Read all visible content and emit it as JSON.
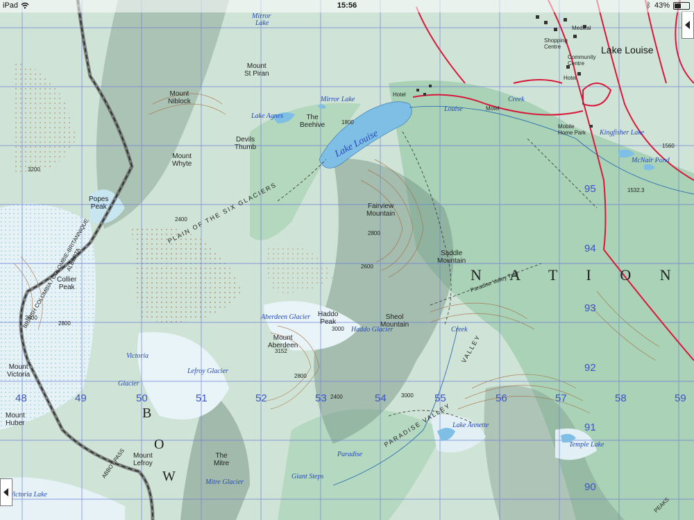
{
  "status_bar": {
    "device": "iPad",
    "time": "15:56",
    "bluetooth_icon": "bluetooth-icon",
    "battery_percent": "43%",
    "battery_level": 0.43
  },
  "map": {
    "town": "Lake Louise",
    "region_text": "N A T I O N",
    "bow_letters": [
      "B",
      "O",
      "W"
    ],
    "peaks": [
      {
        "name": "Mount",
        "name2": "St Piran"
      },
      {
        "name": "Mount",
        "name2": "Niblock"
      },
      {
        "name": "The",
        "name2": "Beehive"
      },
      {
        "name": "Devils",
        "name2": "Thumb"
      },
      {
        "name": "Mount",
        "name2": "Whyte"
      },
      {
        "name": "Popes",
        "name2": "Peak"
      },
      {
        "name": "Collier",
        "name2": "Peak"
      },
      {
        "name": "Fairview",
        "name2": "Mountain"
      },
      {
        "name": "Saddle",
        "name2": "Mountain"
      },
      {
        "name": "Haddo",
        "name2": "Peak"
      },
      {
        "name": "Sheol",
        "name2": "Mountain"
      },
      {
        "name": "Mount",
        "name2": "Aberdeen"
      },
      {
        "name": "Mount",
        "name2": "Victoria"
      },
      {
        "name": "Mount",
        "name2": "Huber"
      },
      {
        "name": "Mount",
        "name2": "Lefroy"
      },
      {
        "name": "The",
        "name2": "Mitre"
      }
    ],
    "water": {
      "lake_louise": "Lake Louise",
      "lake_agnes": "Lake Agnes",
      "mirror_lake": "Mirror Lake",
      "louise_creek": "Louise",
      "creek": "Creek",
      "kingfisher_lake": "Kingfisher Lake",
      "mcnair_pond": "McNair Pond",
      "aberdeen_glacier": "Aberdeen Glacier",
      "haddo_glacier": "Haddo Glacier",
      "victoria": "Victoria",
      "glacier": "Glacier",
      "lefroy_glacier": "Lefroy Glacier",
      "lake_annette": "Lake Annette",
      "temple_lake": "Temple Lake",
      "paradise_creek": "Paradise",
      "paradise_creek2": "Creek",
      "mitre_glacier": "Mitre Glacier",
      "giant_steps": "Giant Steps",
      "victoria_lake": "Victoria Lake",
      "mirror_label": "Mirror",
      "lake_label": "Lake"
    },
    "route_labels": {
      "six_glaciers": "PLAIN OF THE SIX GLACIERS",
      "paradise_valley": "PARADISE VALLEY",
      "valley": "VALLEY",
      "paradise_valley_trail": "Paradise Valley Trail",
      "bc_alberta": "BRITISH COLUMBIA / COLOMBIE-BRITANNIQUE",
      "alberta": "ALBERTA",
      "abbot_pass": "ABBOT PASS",
      "peaks": "PEAKS"
    },
    "places": {
      "hotel": "Hotel",
      "motel": "Motel",
      "mobile_home_park": "Mobile Home Park",
      "community_centre": "Community Centre",
      "shopping_centre": "Shopping Centre",
      "hotel2": "Hotel",
      "medical": "Medical"
    },
    "elevations": [
      "2800",
      "2400",
      "2800",
      "3000",
      "3152",
      "2400",
      "2800",
      "3000",
      "1560",
      "1532.3",
      "2600",
      "1800",
      "2800",
      "3200"
    ],
    "grid_x": [
      "48",
      "49",
      "50",
      "51",
      "52",
      "53",
      "54",
      "55",
      "56",
      "57",
      "58",
      "59"
    ],
    "grid_y": [
      "95",
      "94",
      "93",
      "92",
      "91",
      "90"
    ],
    "colors": {
      "land": "#cfe3d6",
      "forest": "#a9d2b6",
      "glacier": "#e9f4f8",
      "ice_blue": "#8ec9dd",
      "contour": "#a36a3a",
      "grid": "#6d7fd6",
      "road": "#d8183a",
      "water": "#7fbfe6",
      "border": "#5a5a5a"
    }
  }
}
